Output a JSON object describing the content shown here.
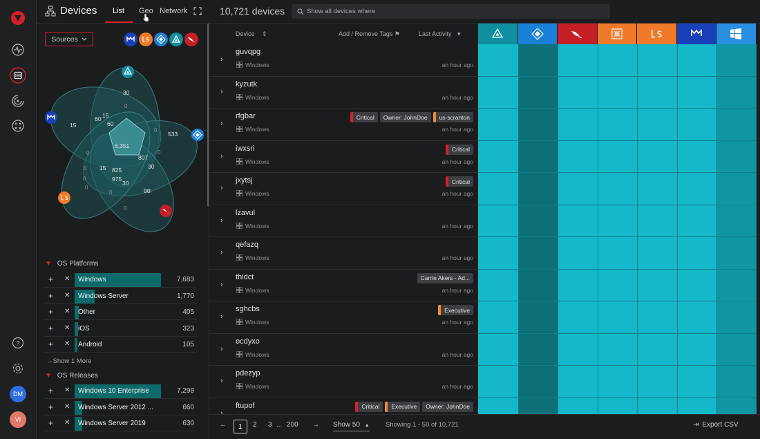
{
  "header": {
    "title": "Devices",
    "tabs": [
      "List",
      "Geo",
      "Network"
    ],
    "device_count": "10,721 devices",
    "search_placeholder": "Show all devices where"
  },
  "rail": {
    "avatars": [
      "DM",
      "VI"
    ]
  },
  "sources": {
    "label": "Sources"
  },
  "venn": {
    "labels": [
      "30",
      "15",
      "60",
      "15",
      "60",
      "533",
      "6,351",
      "807",
      "30",
      "15",
      "825",
      "975",
      "30",
      "90",
      "0",
      "0",
      "0",
      "0",
      "0",
      "0",
      "0",
      "0",
      "0",
      "0"
    ]
  },
  "os_platforms": {
    "title": "OS Platforms",
    "rows": [
      {
        "label": "Windows",
        "count": "7,683",
        "fill": 1.0
      },
      {
        "label": "Windows Server",
        "count": "1,770",
        "fill": 0.23
      },
      {
        "label": "Other",
        "count": "405",
        "fill": 0.05
      },
      {
        "label": "iOS",
        "count": "323",
        "fill": 0.04
      },
      {
        "label": "Android",
        "count": "105",
        "fill": 0.02
      }
    ],
    "show_more": "Show 1 More"
  },
  "os_releases": {
    "title": "OS Releases",
    "rows": [
      {
        "label": "Windows 10 Enterprise",
        "count": "7,298",
        "fill": 1.0
      },
      {
        "label": "Windows Server 2012 ...",
        "count": "660",
        "fill": 0.09
      },
      {
        "label": "Windows Server 2019",
        "count": "630",
        "fill": 0.09
      }
    ]
  },
  "table": {
    "col_device": "Device",
    "col_tags": "Add / Remove Tags",
    "col_activity": "Last Activity",
    "rows": [
      {
        "name": "guvqpg",
        "os": "Windows",
        "time": "an hour ago",
        "tags": []
      },
      {
        "name": "kyzutk",
        "os": "Windows",
        "time": "an hour ago",
        "tags": []
      },
      {
        "name": "rfgbar",
        "os": "Windows",
        "time": "an hour ago",
        "tags": [
          {
            "t": "Critical",
            "c": "red"
          },
          {
            "t": "Owner: JohnDoe",
            "c": "plain"
          },
          {
            "t": "us-scranton",
            "c": "orange"
          }
        ]
      },
      {
        "name": "iwxsri",
        "os": "Windows",
        "time": "an hour ago",
        "tags": [
          {
            "t": "Critical",
            "c": "red"
          }
        ]
      },
      {
        "name": "jxytsj",
        "os": "Windows",
        "time": "an hour ago",
        "tags": [
          {
            "t": "Critical",
            "c": "red"
          }
        ]
      },
      {
        "name": "lzavul",
        "os": "Windows",
        "time": "an hour ago",
        "tags": []
      },
      {
        "name": "qefazq",
        "os": "Windows",
        "time": "an hour ago",
        "tags": []
      },
      {
        "name": "thidct",
        "os": "Windows",
        "time": "an hour ago",
        "tags": [
          {
            "t": "Carrie Akers - Ad...",
            "c": "plain"
          }
        ]
      },
      {
        "name": "sghcbs",
        "os": "Windows",
        "time": "an hour ago",
        "tags": [
          {
            "t": "Executive",
            "c": "orange"
          }
        ]
      },
      {
        "name": "ocdyxo",
        "os": "Windows",
        "time": "an hour ago",
        "tags": []
      },
      {
        "name": "pdezyp",
        "os": "Windows",
        "time": "an hour ago",
        "tags": []
      },
      {
        "name": "ftupof",
        "os": "",
        "time": "",
        "tags": [
          {
            "t": "Critical",
            "c": "red"
          },
          {
            "t": "Executive",
            "c": "orange"
          },
          {
            "t": "Owner: JohnDoe",
            "c": "plain"
          }
        ]
      }
    ]
  },
  "grid": {
    "columns": [
      {
        "icon": "triangle-icon",
        "bg": "#0f8fa0"
      },
      {
        "icon": "diamond-icon",
        "bg": "#1a7fd6"
      },
      {
        "icon": "falcon-icon",
        "bg": "#c41f25"
      },
      {
        "icon": "crosshair-icon",
        "bg": "#f07a2a"
      },
      {
        "icon": "ls-icon",
        "bg": "#f07a2a"
      },
      {
        "icon": "neb-icon",
        "bg": "#1840b8"
      },
      {
        "icon": "windows-icon",
        "bg": "#2a8fe0"
      }
    ],
    "cell_light": "#14b8c8",
    "cell_dark": "#0d6f78"
  },
  "footer": {
    "pages": [
      "1",
      "2",
      "3",
      "...",
      "200"
    ],
    "show": "Show 50",
    "showing": "Showing 1 - 50 of 10,721",
    "export": "Export CSV"
  }
}
